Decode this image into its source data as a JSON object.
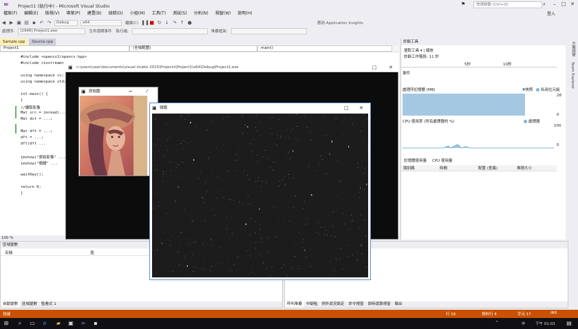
{
  "window": {
    "title": "Project1 (執行中) - Microsoft Visual Studio",
    "quick_launch": "快速啟動 (Ctrl+Q)",
    "user": "登入"
  },
  "menu": [
    "檔案(F)",
    "編輯(E)",
    "檢視(V)",
    "專案(P)",
    "建置(B)",
    "偵錯(D)",
    "小組(M)",
    "工具(T)",
    "測試(S)",
    "分析(N)",
    "視窗(W)",
    "說明(H)"
  ],
  "toolbar": {
    "config": "Debug",
    "platform": "x64",
    "continue": "繼續(C)",
    "process_label": "處理序:",
    "process": "[2948] Project1.exe",
    "lifecycle": "生命週期事件",
    "thread_label": "執行緒:",
    "stack_label": "堆疊框架:",
    "app_insights": "應用 Application Insights"
  },
  "editor": {
    "tabs": [
      {
        "label": "Sample.cpp",
        "active": true
      },
      {
        "label": "Source.cpp",
        "active": false
      }
    ],
    "nav": {
      "project": "Project1",
      "scope": "(全域範圍)",
      "member": "main()"
    },
    "lines": [
      "#include <opencv2/opencv.hpp>",
      "#include <iostream>",
      "",
      "using namespace cv;",
      "using namespace std;",
      "",
      "int main() {",
      "{",
      "    //讀取影像",
      "    Mat src = imread(...);",
      "    Mat dst = ...;",
      "",
      "    Mat dft = ...;",
      "    dft = ...;",
      "    dft(dft ...",
      "",
      "    imshow(\"原始影像\" ...",
      "    imshow(\"頻譜\" ...",
      "",
      "    waitKey();",
      "",
      "    return 0;",
      "}"
    ],
    "zoom": "100 %"
  },
  "diagnostics": {
    "title": "診斷工具",
    "toolbar": "選取工具 ▾  |  縮放",
    "session": "診斷工作階段: 11 秒",
    "ticks": [
      "5秒",
      "10秒"
    ],
    "events": "事件",
    "memory_title": "處理序記憶體 (MB)",
    "legend_snapshot": "快照",
    "legend_private": "私用位元組",
    "mem_max": "28",
    "mem_min": "0",
    "cpu_title": "CPU 使用率 (所有處理器的 %)",
    "cpu_max": "100",
    "cpu_min": "0",
    "cpu_legend": "處理器",
    "tabs": [
      "記憶體使用量",
      "CPU 使用量"
    ],
    "columns": [
      "識別碼",
      "時間",
      "配置 (差異)",
      "堆積大小"
    ]
  },
  "side_tabs": [
    "方案總管",
    "Team Explorer"
  ],
  "bottom_left": {
    "title": "區域變數",
    "columns": [
      "名稱",
      "值"
    ],
    "tabs": [
      "自動變數",
      "區域變數",
      "監看式 1"
    ]
  },
  "bottom_right": {
    "title": "",
    "tabs": [
      "呼叫堆疊",
      "中斷點",
      "例外狀況設定",
      "命令視窗",
      "即時運算視窗",
      "輸出"
    ]
  },
  "status": {
    "left": "就緒",
    "line": "行 16",
    "col": "字元 17",
    "ins": "INS",
    "col_label": "資料行 4"
  },
  "console": {
    "title": "c:\\users\\user\\documents\\visual studio 2015\\Projects\\Project1\\x64\\Debug\\Project1.exe"
  },
  "image_window_1": {
    "title": "原始圖"
  },
  "image_window_2": {
    "title": "頻譜"
  },
  "taskbar": {
    "time": "下午 01:03",
    "date": "",
    "ime": "中",
    "notify": "^"
  },
  "colors": {
    "status_bar": "#ca5100",
    "vs_purple": "#68217a",
    "memory_fill": "#a4c8e1"
  }
}
